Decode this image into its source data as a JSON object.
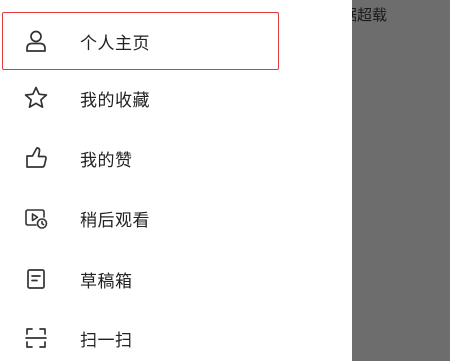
{
  "background_text": "据超载",
  "menu": {
    "items": [
      {
        "label": "个人主页",
        "icon": "person-icon",
        "selected": true
      },
      {
        "label": "我的收藏",
        "icon": "star-icon"
      },
      {
        "label": "我的赞",
        "icon": "thumbs-up-icon"
      },
      {
        "label": "稍后观看",
        "icon": "watch-later-icon"
      },
      {
        "label": "草稿箱",
        "icon": "draft-box-icon"
      },
      {
        "label": "扫一扫",
        "icon": "scan-icon"
      }
    ]
  },
  "colors": {
    "highlight": "#e03a3a",
    "overlay": "#6d6d6d",
    "text": "#222222",
    "icon": "#333333"
  }
}
